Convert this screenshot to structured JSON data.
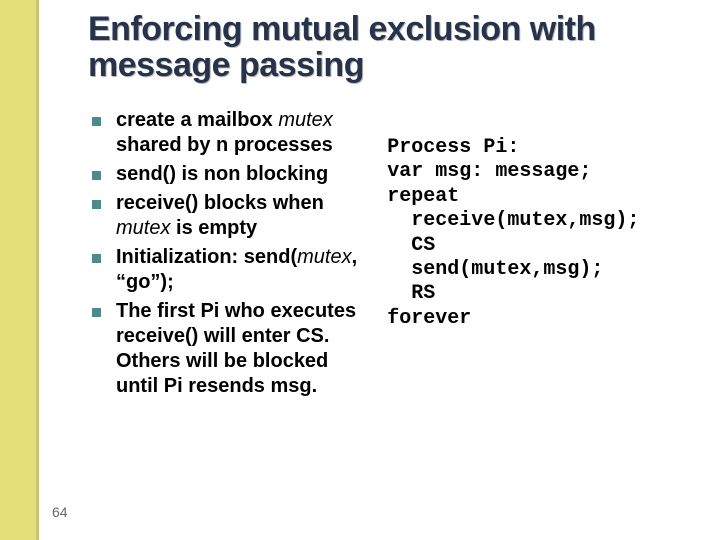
{
  "slide": {
    "title": "Enforcing mutual exclusion with message passing",
    "page_number": "64",
    "bullets": [
      {
        "pre": "create  a mailbox ",
        "mid": "mutex",
        "post": " shared by n processes"
      },
      {
        "pre": "send() is non blocking",
        "mid": "",
        "post": ""
      },
      {
        "pre": "receive() blocks when ",
        "mid": "mutex",
        "post": " is empty"
      },
      {
        "pre": "Initialization: send(",
        "mid": "mutex",
        "post": ", “go”);"
      },
      {
        "pre": "The first Pi who executes receive() will enter CS. Others will be blocked until Pi resends msg.",
        "mid": "",
        "post": ""
      }
    ],
    "code": {
      "l1": "Process Pi:",
      "l2": "var msg: message;",
      "l3": "repeat",
      "l4": "  receive(mutex,msg);",
      "l5": "  CS",
      "l6": "  send(mutex,msg);",
      "l7": "  RS",
      "l8": "forever"
    }
  }
}
